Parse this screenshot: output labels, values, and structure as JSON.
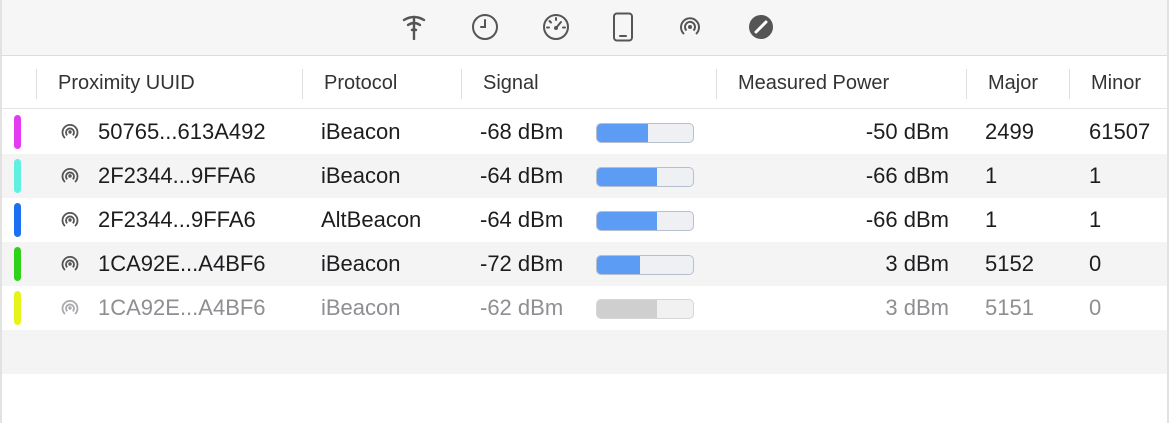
{
  "toolbar": {
    "icons": [
      "wifi-scan-icon",
      "clock-icon",
      "speedometer-icon",
      "phone-icon",
      "beacon-icon",
      "no-entry-icon"
    ]
  },
  "table": {
    "columns": [
      "Proximity UUID",
      "Protocol",
      "Signal",
      "Measured Power",
      "Major",
      "Minor"
    ],
    "rows": [
      {
        "color": "#e53bf0",
        "uuid": "50765...613A492",
        "protocol": "iBeacon",
        "signal": "-68 dBm",
        "signal_fraction": 0.53,
        "power": "-50 dBm",
        "major": "2499",
        "minor": "61507",
        "dim": false
      },
      {
        "color": "#5ff0e0",
        "uuid": "2F2344...9FFA6",
        "protocol": "iBeacon",
        "signal": "-64 dBm",
        "signal_fraction": 0.62,
        "power": "-66 dBm",
        "major": "1",
        "minor": "1",
        "dim": false
      },
      {
        "color": "#1a6ff2",
        "uuid": "2F2344...9FFA6",
        "protocol": "AltBeacon",
        "signal": "-64 dBm",
        "signal_fraction": 0.62,
        "power": "-66 dBm",
        "major": "1",
        "minor": "1",
        "dim": false
      },
      {
        "color": "#2fd11a",
        "uuid": "1CA92E...A4BF6",
        "protocol": "iBeacon",
        "signal": "-72 dBm",
        "signal_fraction": 0.45,
        "power": "3 dBm",
        "major": "5152",
        "minor": "0",
        "dim": false
      },
      {
        "color": "#e6f41c",
        "uuid": "1CA92E...A4BF6",
        "protocol": "iBeacon",
        "signal": "-62 dBm",
        "signal_fraction": 0.63,
        "power": "3 dBm",
        "major": "5151",
        "minor": "0",
        "dim": true
      }
    ]
  }
}
